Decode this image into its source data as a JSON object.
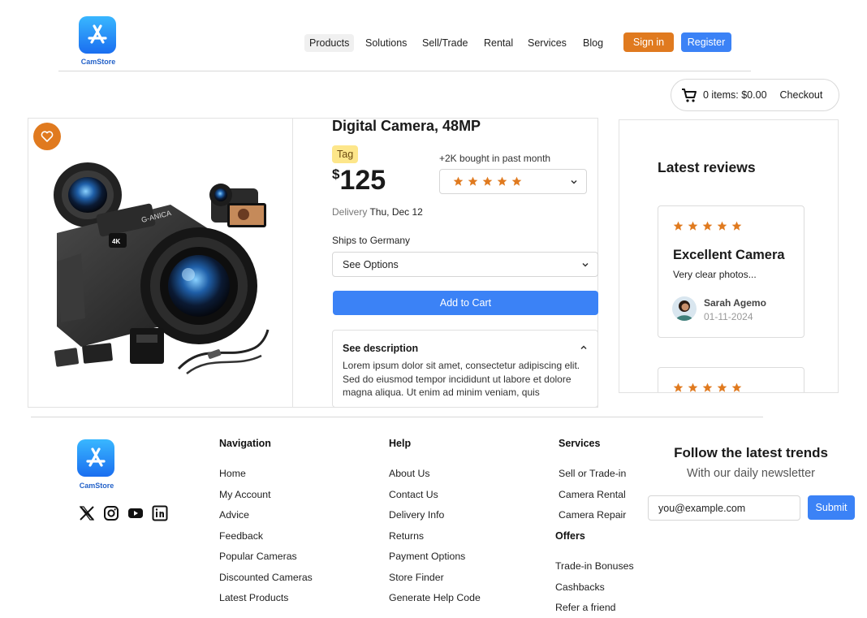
{
  "brand": {
    "name": "CamStore"
  },
  "nav": {
    "items": [
      {
        "label": "Products",
        "active": true
      },
      {
        "label": "Solutions",
        "active": false
      },
      {
        "label": "Sell/Trade",
        "active": false
      },
      {
        "label": "Rental",
        "active": false
      },
      {
        "label": "Services",
        "active": false
      },
      {
        "label": "Blog",
        "active": false
      }
    ],
    "sign_in": "Sign in",
    "register": "Register"
  },
  "cart": {
    "summary": "0 items: $0.00",
    "checkout": "Checkout"
  },
  "product": {
    "title": "Digital Camera, 48MP",
    "tag": "Tag",
    "currency": "$",
    "price": "125",
    "bought": "+2K bought in past month",
    "rating": 5,
    "delivery_label": "Delivery",
    "delivery_date": "Thu, Dec 12",
    "ships_to": "Ships to Germany",
    "options_select": "See Options",
    "add_to_cart": "Add to Cart",
    "description_title": "See description",
    "description_text": "Lorem ipsum dolor sit amet, consectetur adipiscing elit. Sed do eiusmod tempor incididunt ut labore et dolore magna aliqua. Ut enim ad minim veniam, quis",
    "image_brand_text": "G-ANICA",
    "image_badge_text": "4K"
  },
  "reviews": {
    "title": "Latest reviews",
    "items": [
      {
        "rating": 5,
        "title": "Excellent Camera",
        "text": "Very clear photos...",
        "author": "Sarah Agemo",
        "date": "01-11-2024"
      },
      {
        "rating": 5
      }
    ]
  },
  "footer": {
    "navigation": {
      "title": "Navigation",
      "links": [
        "Home",
        "My Account",
        "Advice",
        "Feedback",
        "Popular Cameras",
        "Discounted Cameras",
        "Latest Products"
      ]
    },
    "help": {
      "title": "Help",
      "links": [
        "About Us",
        "Contact Us",
        "Delivery Info",
        "Returns",
        "Payment Options",
        "Store Finder",
        "Generate Help Code"
      ]
    },
    "services": {
      "title": "Services",
      "links": [
        "Sell or Trade-in",
        "Camera Rental",
        "Camera Repair"
      ]
    },
    "offers": {
      "title": "Offers",
      "links": [
        "Trade-in Bonuses",
        "Cashbacks",
        "Refer a friend"
      ]
    },
    "newsletter": {
      "title": "Follow the latest trends",
      "subtitle": "With our daily newsletter",
      "placeholder": "you@example.com",
      "submit": "Submit"
    },
    "social": [
      "x-icon",
      "instagram-icon",
      "youtube-icon",
      "linkedin-icon"
    ]
  },
  "colors": {
    "accent_orange": "#e07a1f",
    "accent_blue": "#3b82f6",
    "star": "#e07a1f",
    "tag_bg": "#fde68a"
  }
}
